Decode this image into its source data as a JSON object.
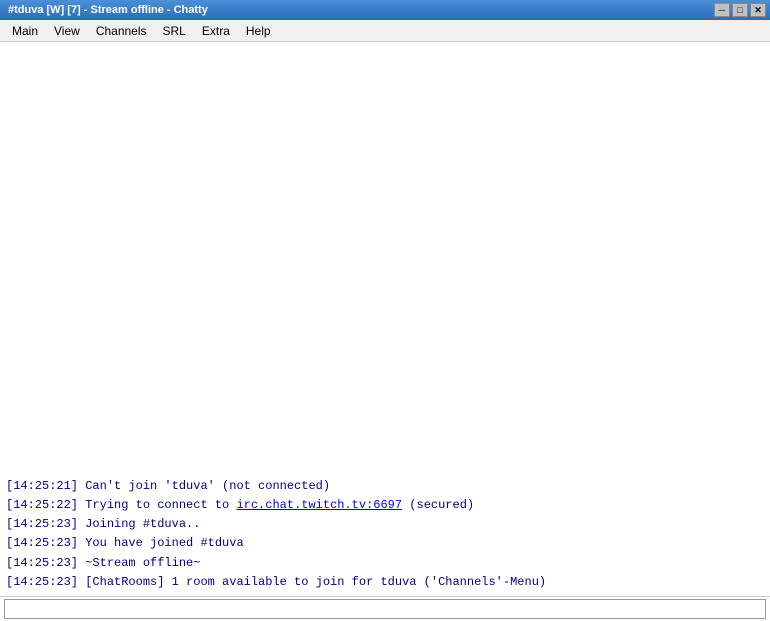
{
  "window": {
    "title": "#tduva [W] [7] - Stream offline - Chatty",
    "app_name": "Chatty"
  },
  "title_bar": {
    "text": "#tduva [W] [7] - Stream offline - Chatty",
    "btn_minimize": "─",
    "btn_maximize": "□",
    "btn_close": "✕"
  },
  "menu": {
    "items": [
      {
        "id": "main",
        "label": "Main"
      },
      {
        "id": "view",
        "label": "View"
      },
      {
        "id": "channels",
        "label": "Channels"
      },
      {
        "id": "srl",
        "label": "SRL"
      },
      {
        "id": "extra",
        "label": "Extra"
      },
      {
        "id": "help",
        "label": "Help"
      }
    ]
  },
  "messages": [
    {
      "id": 1,
      "timestamp": "[14:25:21]",
      "text": " Can't join 'tduva' (not connected)",
      "has_link": false
    },
    {
      "id": 2,
      "timestamp": "[14:25:22]",
      "text_before": " Trying to connect to ",
      "link_text": "irc.chat.twitch.tv:6697",
      "link_href": "irc.chat.twitch.tv:6697",
      "text_after": " (secured)",
      "has_link": true
    },
    {
      "id": 3,
      "timestamp": "[14:25:23]",
      "text": " Joining #tduva..",
      "has_link": false
    },
    {
      "id": 4,
      "timestamp": "[14:25:23]",
      "text": " You have joined #tduva",
      "has_link": false
    },
    {
      "id": 5,
      "timestamp": "[14:25:23]",
      "text": " ~Stream offline~",
      "has_link": false
    },
    {
      "id": 6,
      "timestamp": "[14:25:23]",
      "text": " [ChatRooms] 1 room available to join for tduva ('Channels'-Menu)",
      "has_link": false
    }
  ],
  "input": {
    "placeholder": "",
    "value": ""
  }
}
